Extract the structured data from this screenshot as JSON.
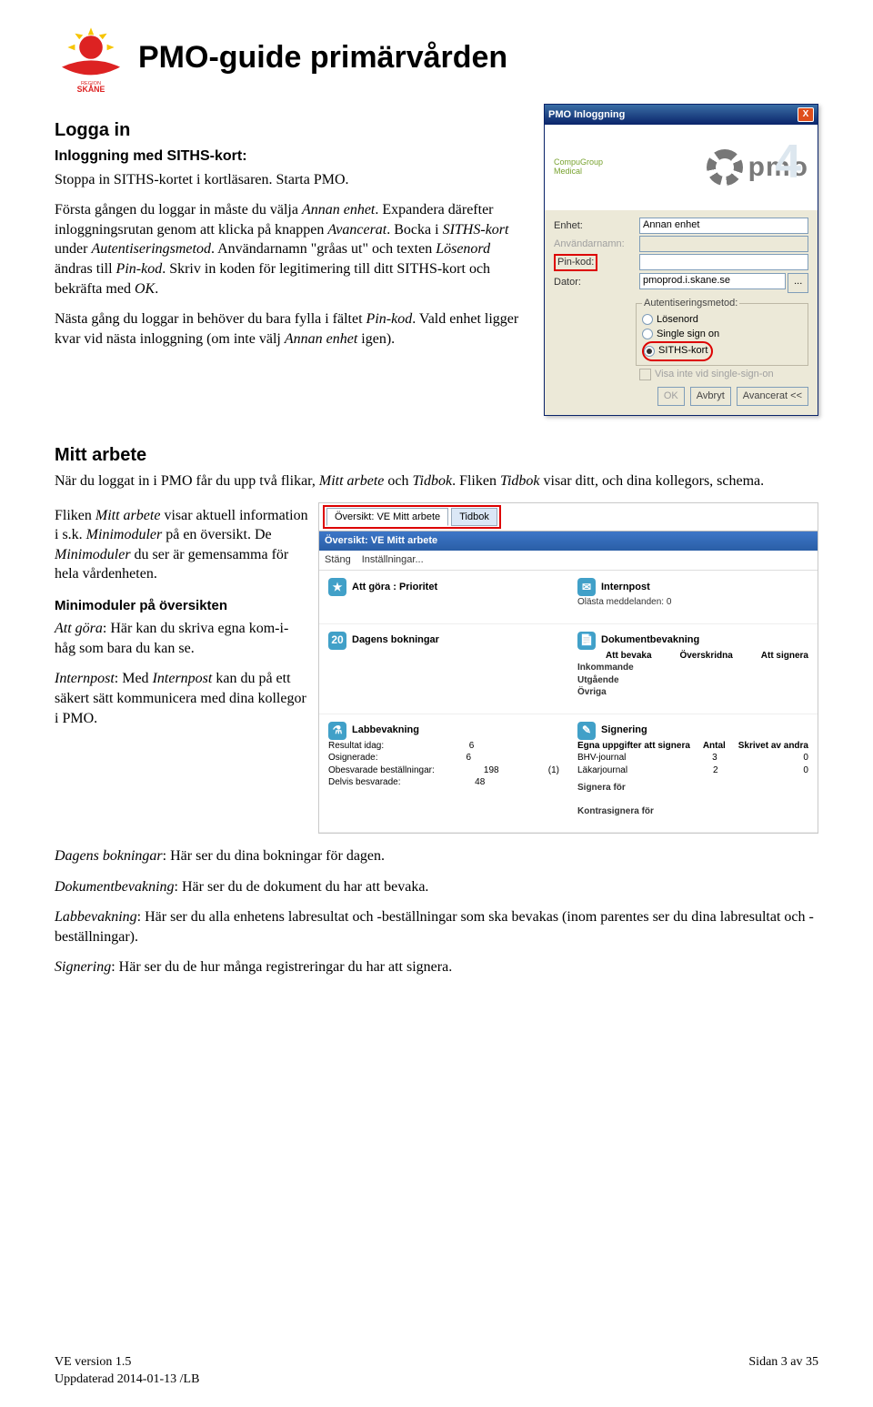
{
  "header": {
    "title": "PMO-guide primärvården",
    "logo_caption": "REGION SKÅNE"
  },
  "section_logga": {
    "heading": "Logga in",
    "subheading": "Inloggning med SITHS-kort:",
    "p1": "Stoppa in SITHS-kortet i kortläsaren. Starta PMO.",
    "p2a": "Första gången du loggar in måste du välja ",
    "p2b_em": "Annan enhet",
    "p2c": ". Expandera därefter inloggningsrutan genom att klicka på knappen ",
    "p2d_em": "Avancerat",
    "p2e": ". Bocka i ",
    "p2f_em": "SITHS-kort",
    "p2g": " under ",
    "p2h_em": "Autentiseringsmetod",
    "p2i": ". Användarnamn \"gråas ut\" och texten ",
    "p2j_em": "Lösenord",
    "p2k": " ändras till ",
    "p2l_em": "Pin-kod",
    "p2m": ". Skriv in koden för legitimering till ditt SITHS-kort och bekräfta med ",
    "p2n_em": "OK",
    "p2o": ".",
    "p3a": "Nästa gång du loggar in behöver du bara fylla i fältet ",
    "p3b_em": "Pin-kod",
    "p3c": ". Vald enhet ligger kvar vid nästa inloggning (om inte välj ",
    "p3d_em": "Annan enhet",
    "p3e": " igen)."
  },
  "login": {
    "title": "PMO Inloggning",
    "brand": "pmo",
    "ghost": "4",
    "cgm": "CompuGroup\nMedical",
    "labels": {
      "enhet": "Enhet:",
      "anvandarnamn": "Användarnamn:",
      "pinkod": "Pin-kod:",
      "dator": "Dator:",
      "auth_legend": "Autentiseringsmetod:",
      "opt_losenord": "Lösenord",
      "opt_single": "Single sign on",
      "opt_siths": "SITHS-kort",
      "chk_visa": "Visa inte vid single-sign-on"
    },
    "values": {
      "enhet": "Annan enhet",
      "dator": "pmoprod.i.skane.se"
    },
    "buttons": {
      "ok": "OK",
      "avbryt": "Avbryt",
      "avancerat": "Avancerat <<"
    }
  },
  "section_mitt": {
    "heading": "Mitt arbete",
    "intro_a": "När du loggat in i PMO får du upp två flikar, ",
    "intro_b_em": "Mitt arbete",
    "intro_c": " och ",
    "intro_d_em": "Tidbok",
    "intro_e": ". Fliken ",
    "intro_f_em": "Tidbok",
    "intro_g": " visar ditt, och dina kollegors, schema.",
    "p_ma_a": "Fliken ",
    "p_ma_b_em": "Mitt arbete",
    "p_ma_c": " visar aktuell information i s.k. ",
    "p_ma_d_em": "Minimoduler",
    "p_ma_e": " på en översikt. De ",
    "p_ma_f_em": "Minimoduler",
    "p_ma_g": " du ser är gemensamma för hela vårdenheten.",
    "h_mini": "Minimoduler på översikten",
    "att_gora_a_em": "Att göra",
    "att_gora_b": ": Här kan du skriva egna kom-i-håg som bara du kan se.",
    "internpost_a_em": "Internpost",
    "internpost_b": ": Med ",
    "internpost_c_em": "Internpost",
    "internpost_d": " kan du på ett säkert sätt kommunicera med dina kollegor i PMO.",
    "dagens_a_em": "Dagens bokningar",
    "dagens_b": ": Här ser du dina bokningar för dagen.",
    "dok_a_em": "Dokumentbevakning",
    "dok_b": ": Här ser du de dokument du har att bevaka.",
    "lab_a_em": "Labbevakning",
    "lab_b": ": Här ser du alla enhetens labresultat och -beställningar som ska bevakas (inom parentes ser du dina labresultat och -beställningar).",
    "sign_a_em": "Signering",
    "sign_b": ": Här ser du de hur många registreringar du har att signera."
  },
  "ma_shot": {
    "tab1": "Översikt: VE Mitt arbete",
    "tab2": "Tidbok",
    "blue": "Översikt: VE Mitt arbete",
    "tool1": "Stäng",
    "tool2": "Inställningar...",
    "mod_attgora": "Att göra : Prioritet",
    "mod_intern": "Internpost",
    "intern_line": "Olästa meddelanden:  0",
    "mod_dagens": "Dagens bokningar",
    "mod_dok": "Dokumentbevakning",
    "dok_h1": "Att bevaka",
    "dok_h2": "Överskridna",
    "dok_h3": "Att signera",
    "dok_r1": "Inkommande",
    "dok_r2": "Utgående",
    "dok_r3": "Övriga",
    "mod_lab": "Labbevakning",
    "lab_r1l": "Resultat idag:",
    "lab_r1v": "6",
    "lab_r2l": "Osignerade:",
    "lab_r2v": "6",
    "lab_r3l": "Obesvarade beställningar:",
    "lab_r3v": "198",
    "lab_r3p": "(1)",
    "lab_r4l": "Delvis besvarade:",
    "lab_r4v": "48",
    "mod_sign": "Signering",
    "sign_h1": "Egna uppgifter att signera",
    "sign_h2": "Antal",
    "sign_h3": "Skrivet av andra",
    "sign_r1": "BHV-journal",
    "sign_r1a": "3",
    "sign_r1b": "0",
    "sign_r2": "Läkarjournal",
    "sign_r2a": "2",
    "sign_r2b": "0",
    "sign_sf": "Signera för",
    "sign_kf": "Kontrasignera för"
  },
  "footer": {
    "left1": "VE version 1.5",
    "left2": "Uppdaterad 2014-01-13 /LB",
    "right": "Sidan 3 av 35"
  }
}
